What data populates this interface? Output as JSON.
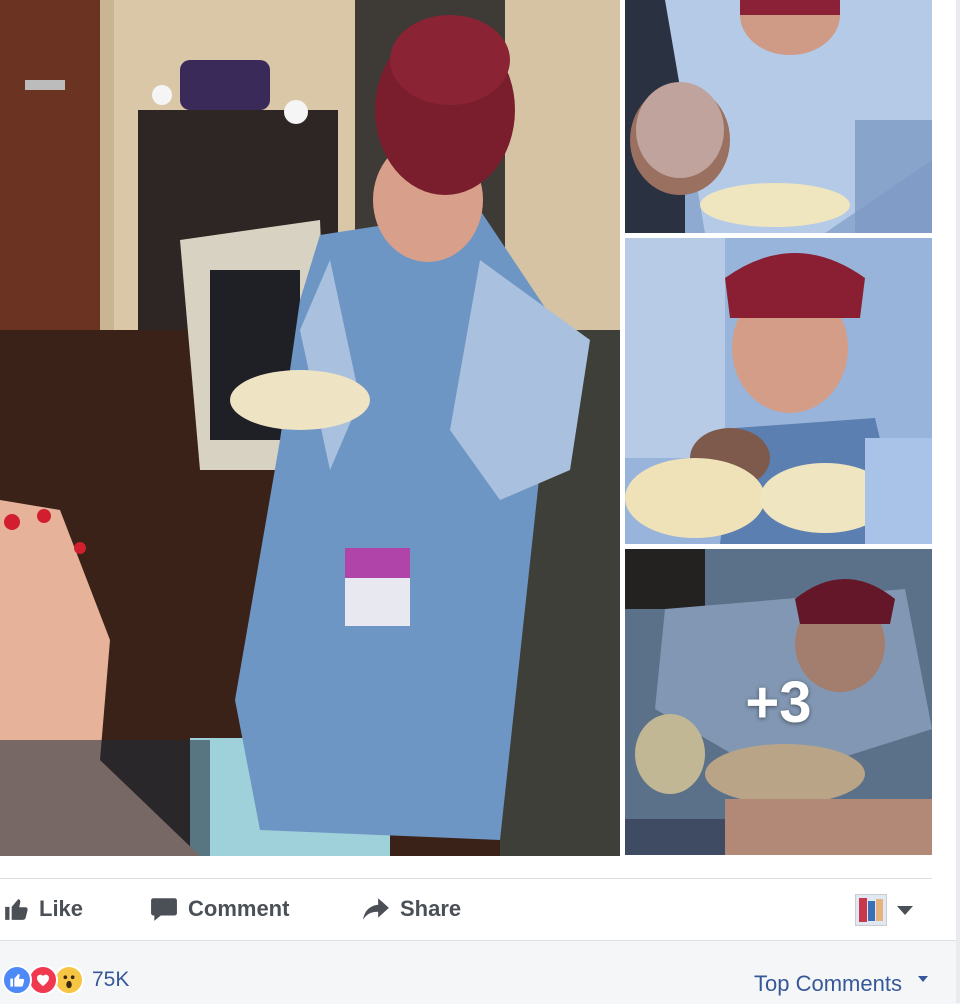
{
  "photos": {
    "main": {
      "icon": "photo-girl-in-surgical-gown"
    },
    "thumbnails": [
      {
        "icon": "photo-newborn-delivery-1"
      },
      {
        "icon": "photo-newborn-delivery-2"
      },
      {
        "icon": "photo-newborn-delivery-3"
      }
    ],
    "more_count": "+3"
  },
  "actions": {
    "like": {
      "label": "Like",
      "icon": "thumbs-up-icon"
    },
    "comment": {
      "label": "Comment",
      "icon": "comment-bubble-icon"
    },
    "share": {
      "label": "Share",
      "icon": "share-arrow-icon"
    }
  },
  "viewer": {
    "icon": "avatar-thumbnail",
    "menu_icon": "chevron-down-icon"
  },
  "reactions": {
    "types": [
      "like",
      "love",
      "wow"
    ],
    "count": "75K",
    "colors": {
      "like": "#4e8af7",
      "love": "#f0384e",
      "wow": "#f7c544"
    }
  },
  "comments": {
    "sort_label": "Top Comments"
  },
  "colors": {
    "link": "#365899",
    "action_text": "#4b4f56",
    "divider": "#dddfe2"
  }
}
